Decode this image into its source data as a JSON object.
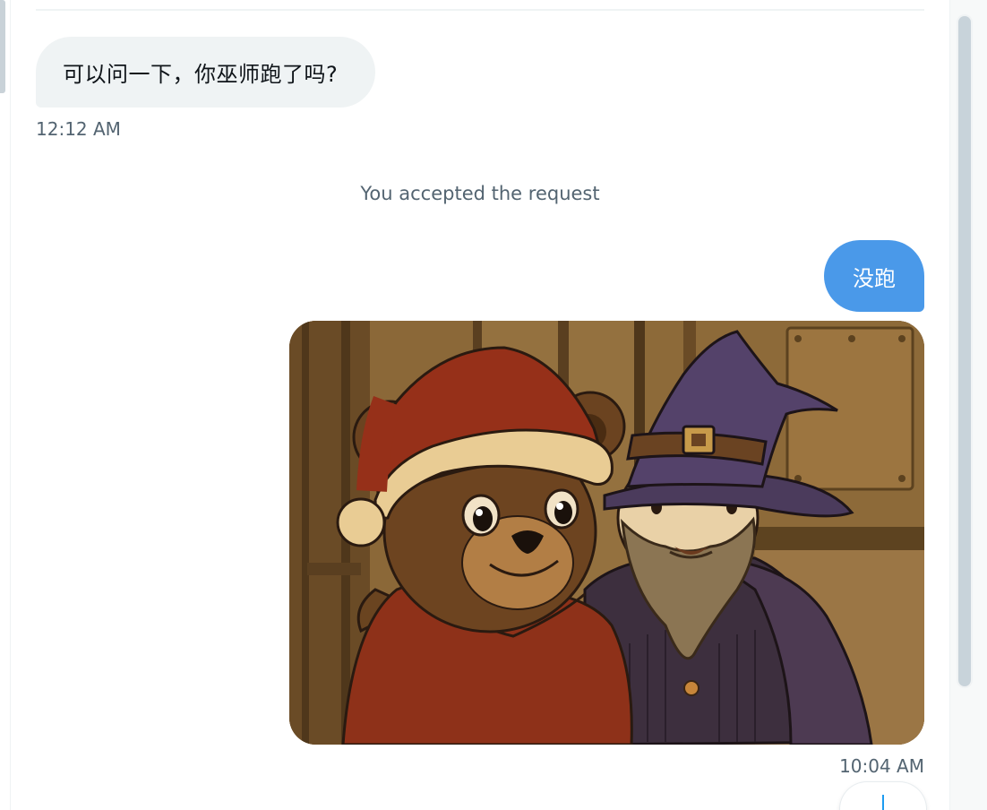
{
  "conversation": {
    "messages": [
      {
        "direction": "received",
        "text": "可以问一下，你巫师跑了吗?",
        "time": "12:12 AM"
      },
      {
        "direction": "system",
        "text": "You accepted the request"
      },
      {
        "direction": "sent",
        "text": "没跑"
      },
      {
        "direction": "sent",
        "kind": "image",
        "image": "cartoon bear in red Santa hat and red hoodie beside a bearded wizard in purple pointed hat",
        "time": "10:04 AM"
      }
    ]
  },
  "controls": {
    "scroll_to_bottom_icon": "arrow-down-icon"
  },
  "colors": {
    "sent_bubble": "#4a99e9",
    "received_bubble": "#eff3f4",
    "timestamp_text": "#536471",
    "scrollbar_thumb": "#c8d3da"
  }
}
